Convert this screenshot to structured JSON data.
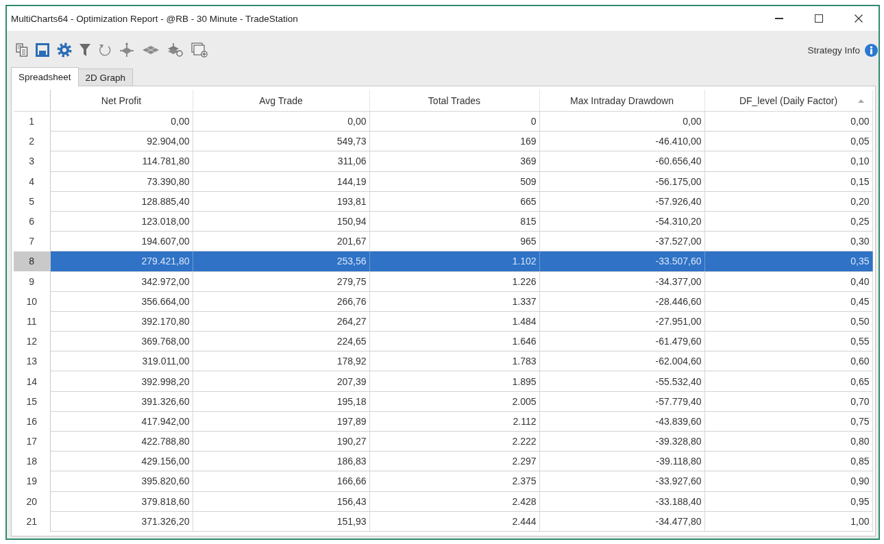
{
  "window": {
    "title": "MultiCharts64 - Optimization Report - @RB - 30 Minute - TradeStation"
  },
  "toolbar": {
    "strategy_info": "Strategy Info"
  },
  "tabs": [
    {
      "label": "Spreadsheet",
      "selected": true
    },
    {
      "label": "2D Graph",
      "selected": false
    }
  ],
  "table": {
    "columns": [
      {
        "label": "Net Profit",
        "sorted": false
      },
      {
        "label": "Avg Trade",
        "sorted": false
      },
      {
        "label": "Total Trades",
        "sorted": false
      },
      {
        "label": "Max Intraday Drawdown",
        "sorted": false
      },
      {
        "label": "DF_level (Daily Factor)",
        "sorted": true
      }
    ],
    "rows": [
      {
        "number": "1",
        "cells": [
          "0,00",
          "0,00",
          "0",
          "0,00",
          "0,00"
        ],
        "selected": false
      },
      {
        "number": "2",
        "cells": [
          "92.904,00",
          "549,73",
          "169",
          "-46.410,00",
          "0,05"
        ],
        "selected": false
      },
      {
        "number": "3",
        "cells": [
          "114.781,80",
          "311,06",
          "369",
          "-60.656,40",
          "0,10"
        ],
        "selected": false
      },
      {
        "number": "4",
        "cells": [
          "73.390,80",
          "144,19",
          "509",
          "-56.175,00",
          "0,15"
        ],
        "selected": false
      },
      {
        "number": "5",
        "cells": [
          "128.885,40",
          "193,81",
          "665",
          "-57.926,40",
          "0,20"
        ],
        "selected": false
      },
      {
        "number": "6",
        "cells": [
          "123.018,00",
          "150,94",
          "815",
          "-54.310,20",
          "0,25"
        ],
        "selected": false
      },
      {
        "number": "7",
        "cells": [
          "194.607,00",
          "201,67",
          "965",
          "-37.527,00",
          "0,30"
        ],
        "selected": false
      },
      {
        "number": "8",
        "cells": [
          "279.421,80",
          "253,56",
          "1.102",
          "-33.507,60",
          "0,35"
        ],
        "selected": true
      },
      {
        "number": "9",
        "cells": [
          "342.972,00",
          "279,75",
          "1.226",
          "-34.377,00",
          "0,40"
        ],
        "selected": false
      },
      {
        "number": "10",
        "cells": [
          "356.664,00",
          "266,76",
          "1.337",
          "-28.446,60",
          "0,45"
        ],
        "selected": false
      },
      {
        "number": "11",
        "cells": [
          "392.170,80",
          "264,27",
          "1.484",
          "-27.951,00",
          "0,50"
        ],
        "selected": false
      },
      {
        "number": "12",
        "cells": [
          "369.768,00",
          "224,65",
          "1.646",
          "-61.479,60",
          "0,55"
        ],
        "selected": false
      },
      {
        "number": "13",
        "cells": [
          "319.011,00",
          "178,92",
          "1.783",
          "-62.004,60",
          "0,60"
        ],
        "selected": false
      },
      {
        "number": "14",
        "cells": [
          "392.998,20",
          "207,39",
          "1.895",
          "-55.532,40",
          "0,65"
        ],
        "selected": false
      },
      {
        "number": "15",
        "cells": [
          "391.326,60",
          "195,18",
          "2.005",
          "-57.779,40",
          "0,70"
        ],
        "selected": false
      },
      {
        "number": "16",
        "cells": [
          "417.942,00",
          "197,89",
          "2.112",
          "-43.839,60",
          "0,75"
        ],
        "selected": false
      },
      {
        "number": "17",
        "cells": [
          "422.788,80",
          "190,27",
          "2.222",
          "-39.328,80",
          "0,80"
        ],
        "selected": false
      },
      {
        "number": "18",
        "cells": [
          "429.156,00",
          "186,83",
          "2.297",
          "-39.118,80",
          "0,85"
        ],
        "selected": false
      },
      {
        "number": "19",
        "cells": [
          "395.820,60",
          "166,66",
          "2.375",
          "-33.927,60",
          "0,90"
        ],
        "selected": false
      },
      {
        "number": "20",
        "cells": [
          "379.818,60",
          "156,43",
          "2.428",
          "-33.188,40",
          "0,95"
        ],
        "selected": false
      },
      {
        "number": "21",
        "cells": [
          "371.326,20",
          "151,93",
          "2.444",
          "-34.477,80",
          "1,00"
        ],
        "selected": false
      }
    ]
  }
}
